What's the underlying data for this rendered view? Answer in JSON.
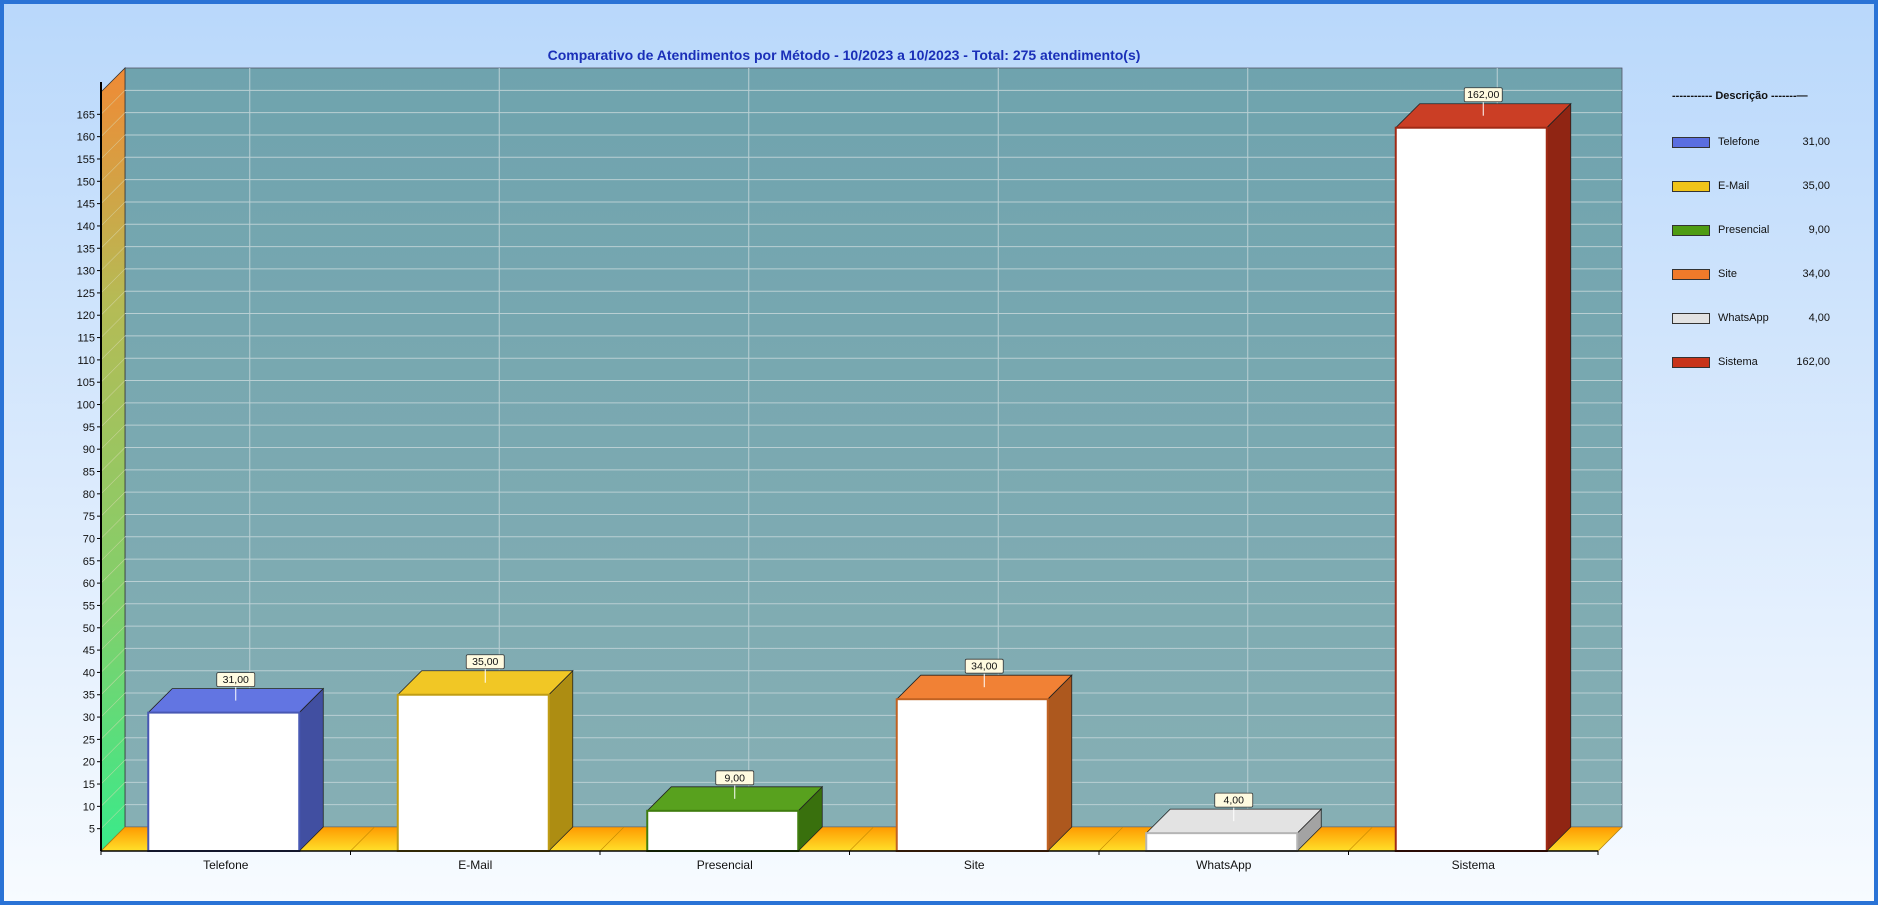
{
  "chart_data": {
    "type": "bar",
    "title": "Comparativo de Atendimentos por Método - 10/2023 a 10/2023 - Total: 275 atendimento(s)",
    "categories": [
      "Telefone",
      "E-Mail",
      "Presencial",
      "Site",
      "WhatsApp",
      "Sistema"
    ],
    "values": [
      31,
      35,
      9,
      34,
      4,
      162
    ],
    "value_labels": [
      "31,00",
      "35,00",
      "9,00",
      "34,00",
      "4,00",
      "162,00"
    ],
    "colors": [
      "#5a6ee0",
      "#f0c419",
      "#4f9c12",
      "#f07a2a",
      "#e2e2e2",
      "#c8341a"
    ],
    "ylim": [
      0,
      170
    ],
    "yticks": [
      5,
      10,
      15,
      20,
      25,
      30,
      35,
      40,
      45,
      50,
      55,
      60,
      65,
      70,
      75,
      80,
      85,
      90,
      95,
      100,
      105,
      110,
      115,
      120,
      125,
      130,
      135,
      140,
      145,
      150,
      155,
      160,
      165
    ],
    "grid": true,
    "legend_position": "right",
    "xlabel": "",
    "ylabel": ""
  },
  "legend": {
    "title": "----------- Descrição -------—",
    "items": [
      {
        "name": "Telefone",
        "value": "31,00"
      },
      {
        "name": "E-Mail",
        "value": "35,00"
      },
      {
        "name": "Presencial",
        "value": "9,00"
      },
      {
        "name": "Site",
        "value": "34,00"
      },
      {
        "name": "WhatsApp",
        "value": "4,00"
      },
      {
        "name": "Sistema",
        "value": "162,00"
      }
    ]
  }
}
